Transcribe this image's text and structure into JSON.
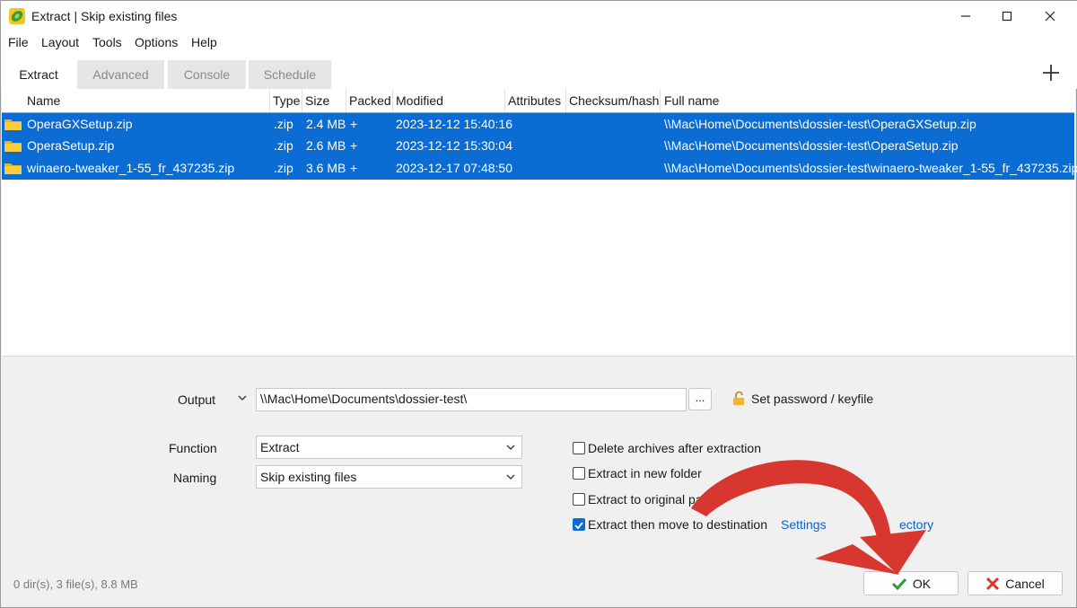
{
  "window": {
    "title": "Extract | Skip existing files"
  },
  "menu": [
    "File",
    "Layout",
    "Tools",
    "Options",
    "Help"
  ],
  "tabs": [
    {
      "label": "Extract",
      "active": true
    },
    {
      "label": "Advanced",
      "active": false
    },
    {
      "label": "Console",
      "active": false
    },
    {
      "label": "Schedule",
      "active": false
    }
  ],
  "columns": [
    "Name",
    "Type",
    "Size",
    "Packed",
    "Modified",
    "Attributes",
    "Checksum/hash",
    "Full name"
  ],
  "files": [
    {
      "name": "OperaGXSetup.zip",
      "type": ".zip",
      "size": "2.4 MB",
      "packed": "+",
      "modified": "2023-12-12 15:40:16",
      "attributes": "",
      "checksum": "",
      "full_name": "\\\\Mac\\Home\\Documents\\dossier-test\\OperaGXSetup.zip"
    },
    {
      "name": "OperaSetup.zip",
      "type": ".zip",
      "size": "2.6 MB",
      "packed": "+",
      "modified": "2023-12-12 15:30:04",
      "attributes": "",
      "checksum": "",
      "full_name": "\\\\Mac\\Home\\Documents\\dossier-test\\OperaSetup.zip"
    },
    {
      "name": "winaero-tweaker_1-55_fr_437235.zip",
      "type": ".zip",
      "size": "3.6 MB",
      "packed": "+",
      "modified": "2023-12-17 07:48:50",
      "attributes": "",
      "checksum": "",
      "full_name": "\\\\Mac\\Home\\Documents\\dossier-test\\winaero-tweaker_1-55_fr_437235.zip"
    }
  ],
  "output": {
    "label": "Output",
    "path": "\\\\Mac\\Home\\Documents\\dossier-test\\",
    "browse_label": "...",
    "password_label": "Set password / keyfile"
  },
  "function": {
    "label": "Function",
    "value": "Extract"
  },
  "naming": {
    "label": "Naming",
    "value": "Skip existing files"
  },
  "options": [
    {
      "label": "Delete archives after extraction",
      "checked": false
    },
    {
      "label": "Extract in new folder",
      "checked": false
    },
    {
      "label": "Extract to original path",
      "checked": false
    },
    {
      "label": "Extract then move to destination",
      "checked": true
    }
  ],
  "settings_link": {
    "part1": "Settings",
    "part2": "ectory"
  },
  "status": "0 dir(s), 3 file(s), 8.8 MB",
  "buttons": {
    "ok": "OK",
    "cancel": "Cancel"
  },
  "colors": {
    "selection": "#0b6cd4",
    "annotation_arrow": "#d7372e",
    "ok_check": "#2a9d3a",
    "cancel_x": "#e0352b"
  },
  "icons": [
    "app-icon",
    "minimize-icon",
    "maximize-icon",
    "close-icon",
    "plus-icon",
    "folder-icon",
    "chevron-down-icon",
    "lock-icon",
    "checkmark-icon",
    "x-icon",
    "annotation-arrow"
  ]
}
